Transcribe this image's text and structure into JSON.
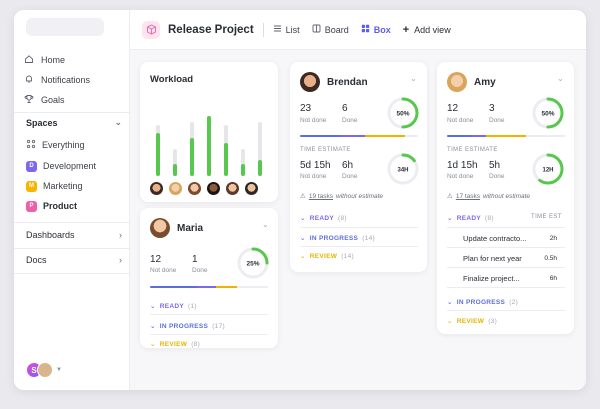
{
  "sidebar": {
    "nav": [
      {
        "label": "Home",
        "icon": "home-icon"
      },
      {
        "label": "Notifications",
        "icon": "bell-icon"
      },
      {
        "label": "Goals",
        "icon": "trophy-icon"
      }
    ],
    "spaces_label": "Spaces",
    "spaces": [
      {
        "label": "Everything",
        "letter": "",
        "color": ""
      },
      {
        "label": "Development",
        "letter": "D",
        "color": "#7b68ee"
      },
      {
        "label": "Marketing",
        "letter": "M",
        "color": "#f7b500"
      },
      {
        "label": "Product",
        "letter": "P",
        "color": "#ef5fa7"
      }
    ],
    "dashboards_label": "Dashboards",
    "docs_label": "Docs",
    "user_initial": "S"
  },
  "header": {
    "title": "Release Project",
    "tabs": [
      {
        "label": "List",
        "active": false
      },
      {
        "label": "Board",
        "active": false
      },
      {
        "label": "Box",
        "active": true
      }
    ],
    "add_view_label": "Add view"
  },
  "workload": {
    "title": "Workload",
    "bars": [
      0.85,
      0.45,
      0.7,
      1.0,
      0.65,
      0.45,
      0.3
    ],
    "bar_totals": [
      0.85,
      0.45,
      0.9,
      1.0,
      0.85,
      0.45,
      0.9
    ]
  },
  "people": [
    {
      "name": "Brendan",
      "not_done": "23",
      "not_done_label": "Not done",
      "done": "6",
      "done_label": "Done",
      "percent_label": "50%",
      "percent": 0.5,
      "time_estimate_label": "TIME ESTIMATE",
      "te_not_done": "5d 15h",
      "te_done": "6h",
      "te_ring_label": "34H",
      "te_ring_percent": 0.15,
      "warn_link": "19 tasks",
      "warn_text": "without estimate",
      "statuses": [
        {
          "label": "READY",
          "count": "(8)",
          "color": "#7b68ee"
        },
        {
          "label": "IN PROGRESS",
          "count": "(14)",
          "color": "#5b6ee1"
        },
        {
          "label": "REVIEW",
          "count": "(14)",
          "color": "#e5b400"
        }
      ]
    },
    {
      "name": "Amy",
      "not_done": "12",
      "not_done_label": "Not done",
      "done": "3",
      "done_label": "Done",
      "percent_label": "50%",
      "percent": 0.5,
      "time_estimate_label": "TIME ESTIMATE",
      "te_not_done": "1d 15h",
      "te_done": "5h",
      "te_ring_label": "12H",
      "te_ring_percent": 0.6,
      "warn_link": "17 tasks",
      "warn_text": "without estimate",
      "ready_label": "READY",
      "ready_count": "(8)",
      "time_est_col": "TIME EST",
      "tasks": [
        {
          "name": "Update contracto...",
          "te": "2h"
        },
        {
          "name": "Plan for next year",
          "te": "0.5h"
        },
        {
          "name": "Finalize project...",
          "te": "6h"
        }
      ],
      "statuses": [
        {
          "label": "IN PROGRESS",
          "count": "(2)",
          "color": "#5b6ee1"
        },
        {
          "label": "REVIEW",
          "count": "(3)",
          "color": "#e5b400"
        }
      ]
    },
    {
      "name": "Maria",
      "not_done": "12",
      "not_done_label": "Not done",
      "done": "1",
      "done_label": "Done",
      "percent_label": "25%",
      "percent": 0.25,
      "statuses": [
        {
          "label": "READY",
          "count": "(1)",
          "color": "#7b68ee"
        },
        {
          "label": "IN PROGRESS",
          "count": "(17)",
          "color": "#5b6ee1"
        },
        {
          "label": "REVIEW",
          "count": "(8)",
          "color": "#e5b400"
        }
      ]
    }
  ],
  "colors": {
    "accent": "#5b5ff0",
    "green": "#57c84d",
    "purple": "#7b68ee",
    "blue": "#5b6ee1",
    "yellow": "#e5b400"
  }
}
